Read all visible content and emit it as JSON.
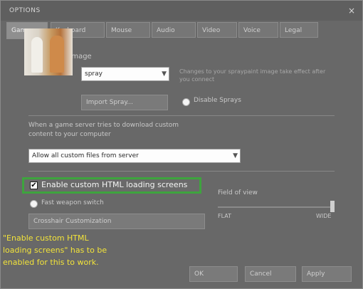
{
  "window": {
    "title": "OPTIONS",
    "close_glyph": "×"
  },
  "tabs": [
    {
      "label": "Game"
    },
    {
      "label": "Keyboard"
    },
    {
      "label": "Mouse"
    },
    {
      "label": "Audio"
    },
    {
      "label": "Video"
    },
    {
      "label": "Voice"
    },
    {
      "label": "Legal"
    }
  ],
  "spray": {
    "heading": "Spraypaint image",
    "selected": "spray",
    "hint": "Changes to your spraypaint image take effect after you connect",
    "import_label": "Import Spray...",
    "disable_label": "Disable Sprays"
  },
  "download": {
    "description": "When a game server tries to download custom content to your computer",
    "selected": "Allow all custom files from server"
  },
  "html_loading": {
    "label": "Enable custom HTML loading screens",
    "checked": "✔"
  },
  "fast_switch": {
    "label": "Fast weapon switch"
  },
  "crosshair": {
    "label": "Crosshair Customization"
  },
  "fov": {
    "title": "Field of view",
    "min_label": "FLAT",
    "max_label": "WIDE",
    "level": 1.0
  },
  "buttons": {
    "ok": "OK",
    "cancel": "Cancel",
    "apply": "Apply"
  },
  "annotation": "\"Enable custom HTML loading screens\" has to be enabled for this to work.",
  "colors": {
    "highlight": "#3ea43e",
    "annotation": "#f2e33a"
  }
}
